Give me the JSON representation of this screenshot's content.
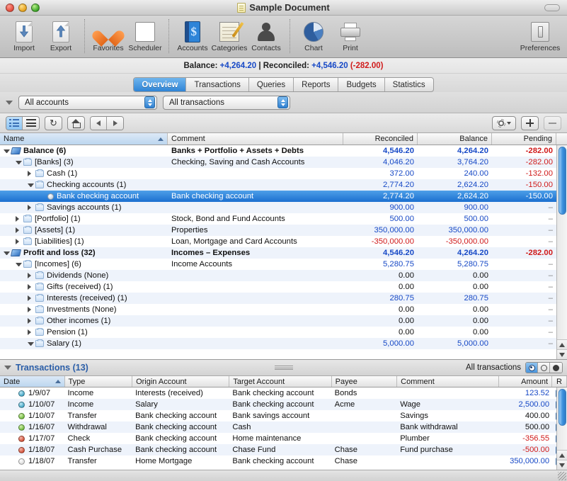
{
  "window": {
    "title": "Sample Document",
    "doc_icon": "document-icon"
  },
  "toolbar": {
    "groups": [
      {
        "items": [
          {
            "label": "Import",
            "icon": "import-icon"
          },
          {
            "label": "Export",
            "icon": "export-icon"
          }
        ]
      },
      {
        "items": [
          {
            "label": "Favorites",
            "icon": "heart-icon"
          },
          {
            "label": "Scheduler",
            "icon": "calendar-icon"
          }
        ]
      },
      {
        "items": [
          {
            "label": "Accounts",
            "icon": "account-book-icon"
          },
          {
            "label": "Categories",
            "icon": "note-pencil-icon"
          },
          {
            "label": "Contacts",
            "icon": "person-icon"
          }
        ]
      },
      {
        "items": [
          {
            "label": "Chart",
            "icon": "pie-chart-icon"
          },
          {
            "label": "Print",
            "icon": "printer-icon"
          }
        ]
      }
    ],
    "preferences": {
      "label": "Preferences",
      "icon": "preferences-switch-icon"
    }
  },
  "balance_strip": {
    "balance_label": "Balance:",
    "balance_value": "+4,264.20",
    "separator": "|",
    "reconciled_label": "Reconciled:",
    "reconciled_value": "+4,546.20",
    "pending_value": "(-282.00)",
    "positive_color": "#1749c6",
    "negative_color": "#d01b1b"
  },
  "tabs": {
    "items": [
      {
        "label": "Overview",
        "active": true
      },
      {
        "label": "Transactions",
        "active": false
      },
      {
        "label": "Queries",
        "active": false
      },
      {
        "label": "Reports",
        "active": false
      },
      {
        "label": "Budgets",
        "active": false
      },
      {
        "label": "Statistics",
        "active": false
      }
    ]
  },
  "filter_bar": {
    "accounts_popup": "All accounts",
    "transactions_popup": "All transactions"
  },
  "control_bar": {
    "view_list": "list-view-icon",
    "view_flat": "flat-view-icon",
    "refresh": "refresh-icon",
    "home": "home-icon",
    "back": "back-arrow-icon",
    "forward": "forward-arrow-icon",
    "gear": "gear-icon",
    "add": "plus-icon",
    "remove": "minus-icon"
  },
  "tree": {
    "columns": [
      {
        "label": "Name",
        "align": "left",
        "sorted": true
      },
      {
        "label": "Comment",
        "align": "left",
        "sorted": false
      },
      {
        "label": "Reconciled",
        "align": "right",
        "sorted": false
      },
      {
        "label": "Balance",
        "align": "right",
        "sorted": false
      },
      {
        "label": "Pending",
        "align": "right",
        "sorted": false
      }
    ],
    "rows": [
      {
        "name": "Balance (6)",
        "depth": 0,
        "twisty": "open",
        "icon": "book-icon",
        "bold": true,
        "comment": "Banks + Portfolio + Assets + Debts",
        "comment_bold": true,
        "reconciled": "4,546.20",
        "reconciled_color": "blue",
        "balance": "4,264.20",
        "balance_color": "blue",
        "pending": "-282.00",
        "pending_color": "red",
        "selected": false
      },
      {
        "name": "[Banks] (3)",
        "depth": 1,
        "twisty": "open",
        "icon": "folder-icon",
        "bold": false,
        "comment": "Checking, Saving and Cash Accounts",
        "comment_bold": false,
        "reconciled": "4,046.20",
        "reconciled_color": "blue",
        "balance": "3,764.20",
        "balance_color": "blue",
        "pending": "-282.00",
        "pending_color": "red",
        "selected": false
      },
      {
        "name": "Cash (1)",
        "depth": 2,
        "twisty": "closed",
        "icon": "folder-icon",
        "bold": false,
        "comment": "",
        "comment_bold": false,
        "reconciled": "372.00",
        "reconciled_color": "blue",
        "balance": "240.00",
        "balance_color": "blue",
        "pending": "-132.00",
        "pending_color": "red",
        "selected": false
      },
      {
        "name": "Checking accounts (1)",
        "depth": 2,
        "twisty": "open",
        "icon": "folder-icon",
        "bold": false,
        "comment": "",
        "comment_bold": false,
        "reconciled": "2,774.20",
        "reconciled_color": "blue",
        "balance": "2,624.20",
        "balance_color": "blue",
        "pending": "-150.00",
        "pending_color": "red",
        "selected": false
      },
      {
        "name": "Bank checking account",
        "depth": 3,
        "twisty": "none",
        "icon": "account-icon",
        "bold": false,
        "comment": "Bank checking account",
        "comment_bold": false,
        "reconciled": "2,774.20",
        "reconciled_color": "blue",
        "balance": "2,624.20",
        "balance_color": "blue",
        "pending": "-150.00",
        "pending_color": "red",
        "selected": true
      },
      {
        "name": "Savings accounts (1)",
        "depth": 2,
        "twisty": "closed",
        "icon": "folder-icon",
        "bold": false,
        "comment": "",
        "comment_bold": false,
        "reconciled": "900.00",
        "reconciled_color": "blue",
        "balance": "900.00",
        "balance_color": "blue",
        "pending": "–",
        "pending_color": "dash",
        "selected": false
      },
      {
        "name": "[Portfolio] (1)",
        "depth": 1,
        "twisty": "closed",
        "icon": "folder-icon",
        "bold": false,
        "comment": "Stock, Bond and Fund Accounts",
        "comment_bold": false,
        "reconciled": "500.00",
        "reconciled_color": "blue",
        "balance": "500.00",
        "balance_color": "blue",
        "pending": "–",
        "pending_color": "dash",
        "selected": false
      },
      {
        "name": "[Assets] (1)",
        "depth": 1,
        "twisty": "closed",
        "icon": "folder-icon",
        "bold": false,
        "comment": "Properties",
        "comment_bold": false,
        "reconciled": "350,000.00",
        "reconciled_color": "blue",
        "balance": "350,000.00",
        "balance_color": "blue",
        "pending": "–",
        "pending_color": "dash",
        "selected": false
      },
      {
        "name": "[Liabilities] (1)",
        "depth": 1,
        "twisty": "closed",
        "icon": "folder-icon",
        "bold": false,
        "comment": "Loan, Mortgage and Card Accounts",
        "comment_bold": false,
        "reconciled": "-350,000.00",
        "reconciled_color": "red",
        "balance": "-350,000.00",
        "balance_color": "red",
        "pending": "–",
        "pending_color": "dash",
        "selected": false
      },
      {
        "name": "Profit and loss (32)",
        "depth": 0,
        "twisty": "open",
        "icon": "book-icon",
        "bold": true,
        "comment": "Incomes – Expenses",
        "comment_bold": true,
        "reconciled": "4,546.20",
        "reconciled_color": "blue",
        "balance": "4,264.20",
        "balance_color": "blue",
        "pending": "-282.00",
        "pending_color": "red",
        "selected": false
      },
      {
        "name": "[Incomes] (6)",
        "depth": 1,
        "twisty": "open",
        "icon": "folder-icon",
        "bold": false,
        "comment": "Income Accounts",
        "comment_bold": false,
        "reconciled": "5,280.75",
        "reconciled_color": "blue",
        "balance": "5,280.75",
        "balance_color": "blue",
        "pending": "–",
        "pending_color": "dash",
        "selected": false
      },
      {
        "name": "Dividends (None)",
        "depth": 2,
        "twisty": "closed",
        "icon": "folder-icon",
        "bold": false,
        "comment": "",
        "comment_bold": false,
        "reconciled": "0.00",
        "reconciled_color": "black",
        "balance": "0.00",
        "balance_color": "black",
        "pending": "–",
        "pending_color": "dash",
        "selected": false
      },
      {
        "name": "Gifts (received) (1)",
        "depth": 2,
        "twisty": "closed",
        "icon": "folder-icon",
        "bold": false,
        "comment": "",
        "comment_bold": false,
        "reconciled": "0.00",
        "reconciled_color": "black",
        "balance": "0.00",
        "balance_color": "black",
        "pending": "–",
        "pending_color": "dash",
        "selected": false
      },
      {
        "name": "Interests (received) (1)",
        "depth": 2,
        "twisty": "closed",
        "icon": "folder-icon",
        "bold": false,
        "comment": "",
        "comment_bold": false,
        "reconciled": "280.75",
        "reconciled_color": "blue",
        "balance": "280.75",
        "balance_color": "blue",
        "pending": "–",
        "pending_color": "dash",
        "selected": false
      },
      {
        "name": "Investments (None)",
        "depth": 2,
        "twisty": "closed",
        "icon": "folder-icon",
        "bold": false,
        "comment": "",
        "comment_bold": false,
        "reconciled": "0.00",
        "reconciled_color": "black",
        "balance": "0.00",
        "balance_color": "black",
        "pending": "–",
        "pending_color": "dash",
        "selected": false
      },
      {
        "name": "Other incomes (1)",
        "depth": 2,
        "twisty": "closed",
        "icon": "folder-icon",
        "bold": false,
        "comment": "",
        "comment_bold": false,
        "reconciled": "0.00",
        "reconciled_color": "black",
        "balance": "0.00",
        "balance_color": "black",
        "pending": "–",
        "pending_color": "dash",
        "selected": false
      },
      {
        "name": "Pension (1)",
        "depth": 2,
        "twisty": "closed",
        "icon": "folder-icon",
        "bold": false,
        "comment": "",
        "comment_bold": false,
        "reconciled": "0.00",
        "reconciled_color": "black",
        "balance": "0.00",
        "balance_color": "black",
        "pending": "–",
        "pending_color": "dash",
        "selected": false
      },
      {
        "name": "Salary (1)",
        "depth": 2,
        "twisty": "open",
        "icon": "folder-icon",
        "bold": false,
        "comment": "",
        "comment_bold": false,
        "reconciled": "5,000.00",
        "reconciled_color": "blue",
        "balance": "5,000.00",
        "balance_color": "blue",
        "pending": "–",
        "pending_color": "dash",
        "selected": false
      }
    ]
  },
  "transactions_panel": {
    "title": "Transactions (13)",
    "scope_label": "All transactions",
    "columns": [
      {
        "label": "Date",
        "align": "left",
        "sorted": true
      },
      {
        "label": "Type",
        "align": "left",
        "sorted": false
      },
      {
        "label": "Origin Account",
        "align": "left",
        "sorted": false
      },
      {
        "label": "Target Account",
        "align": "left",
        "sorted": false
      },
      {
        "label": "Payee",
        "align": "left",
        "sorted": false
      },
      {
        "label": "Comment",
        "align": "left",
        "sorted": false
      },
      {
        "label": "Amount",
        "align": "right",
        "sorted": false
      },
      {
        "label": "R",
        "align": "center",
        "sorted": false
      }
    ],
    "rows": [
      {
        "status": "teal",
        "date": "1/9/07",
        "type": "Income",
        "origin": "Interests (received)",
        "target": "Bank checking account",
        "payee": "Bonds",
        "comment": "",
        "amount": "123.52",
        "amount_color": "blue",
        "reconciled": true
      },
      {
        "status": "teal",
        "date": "1/10/07",
        "type": "Income",
        "origin": "Salary",
        "target": "Bank checking account",
        "payee": "Acme",
        "comment": "Wage",
        "amount": "2,500.00",
        "amount_color": "blue",
        "reconciled": true
      },
      {
        "status": "green",
        "date": "1/10/07",
        "type": "Transfer",
        "origin": "Bank checking account",
        "target": "Bank savings account",
        "payee": "",
        "comment": "Savings",
        "amount": "400.00",
        "amount_color": "black",
        "reconciled": true
      },
      {
        "status": "green",
        "date": "1/16/07",
        "type": "Withdrawal",
        "origin": "Bank checking account",
        "target": "Cash",
        "payee": "",
        "comment": "Bank withdrawal",
        "amount": "500.00",
        "amount_color": "black",
        "reconciled": true
      },
      {
        "status": "red",
        "date": "1/17/07",
        "type": "Check",
        "origin": "Bank checking account",
        "target": "Home maintenance",
        "payee": "",
        "comment": "Plumber",
        "amount": "-356.55",
        "amount_color": "red",
        "reconciled": true
      },
      {
        "status": "red",
        "date": "1/18/07",
        "type": "Cash Purchase",
        "origin": "Bank checking account",
        "target": "Chase Fund",
        "payee": "Chase",
        "comment": "Fund purchase",
        "amount": "-500.00",
        "amount_color": "red",
        "reconciled": true
      },
      {
        "status": "white",
        "date": "1/18/07",
        "type": "Transfer",
        "origin": "Home Mortgage",
        "target": "Bank checking account",
        "payee": "Chase",
        "comment": "",
        "amount": "350,000.00",
        "amount_color": "blue",
        "reconciled": true
      }
    ]
  }
}
